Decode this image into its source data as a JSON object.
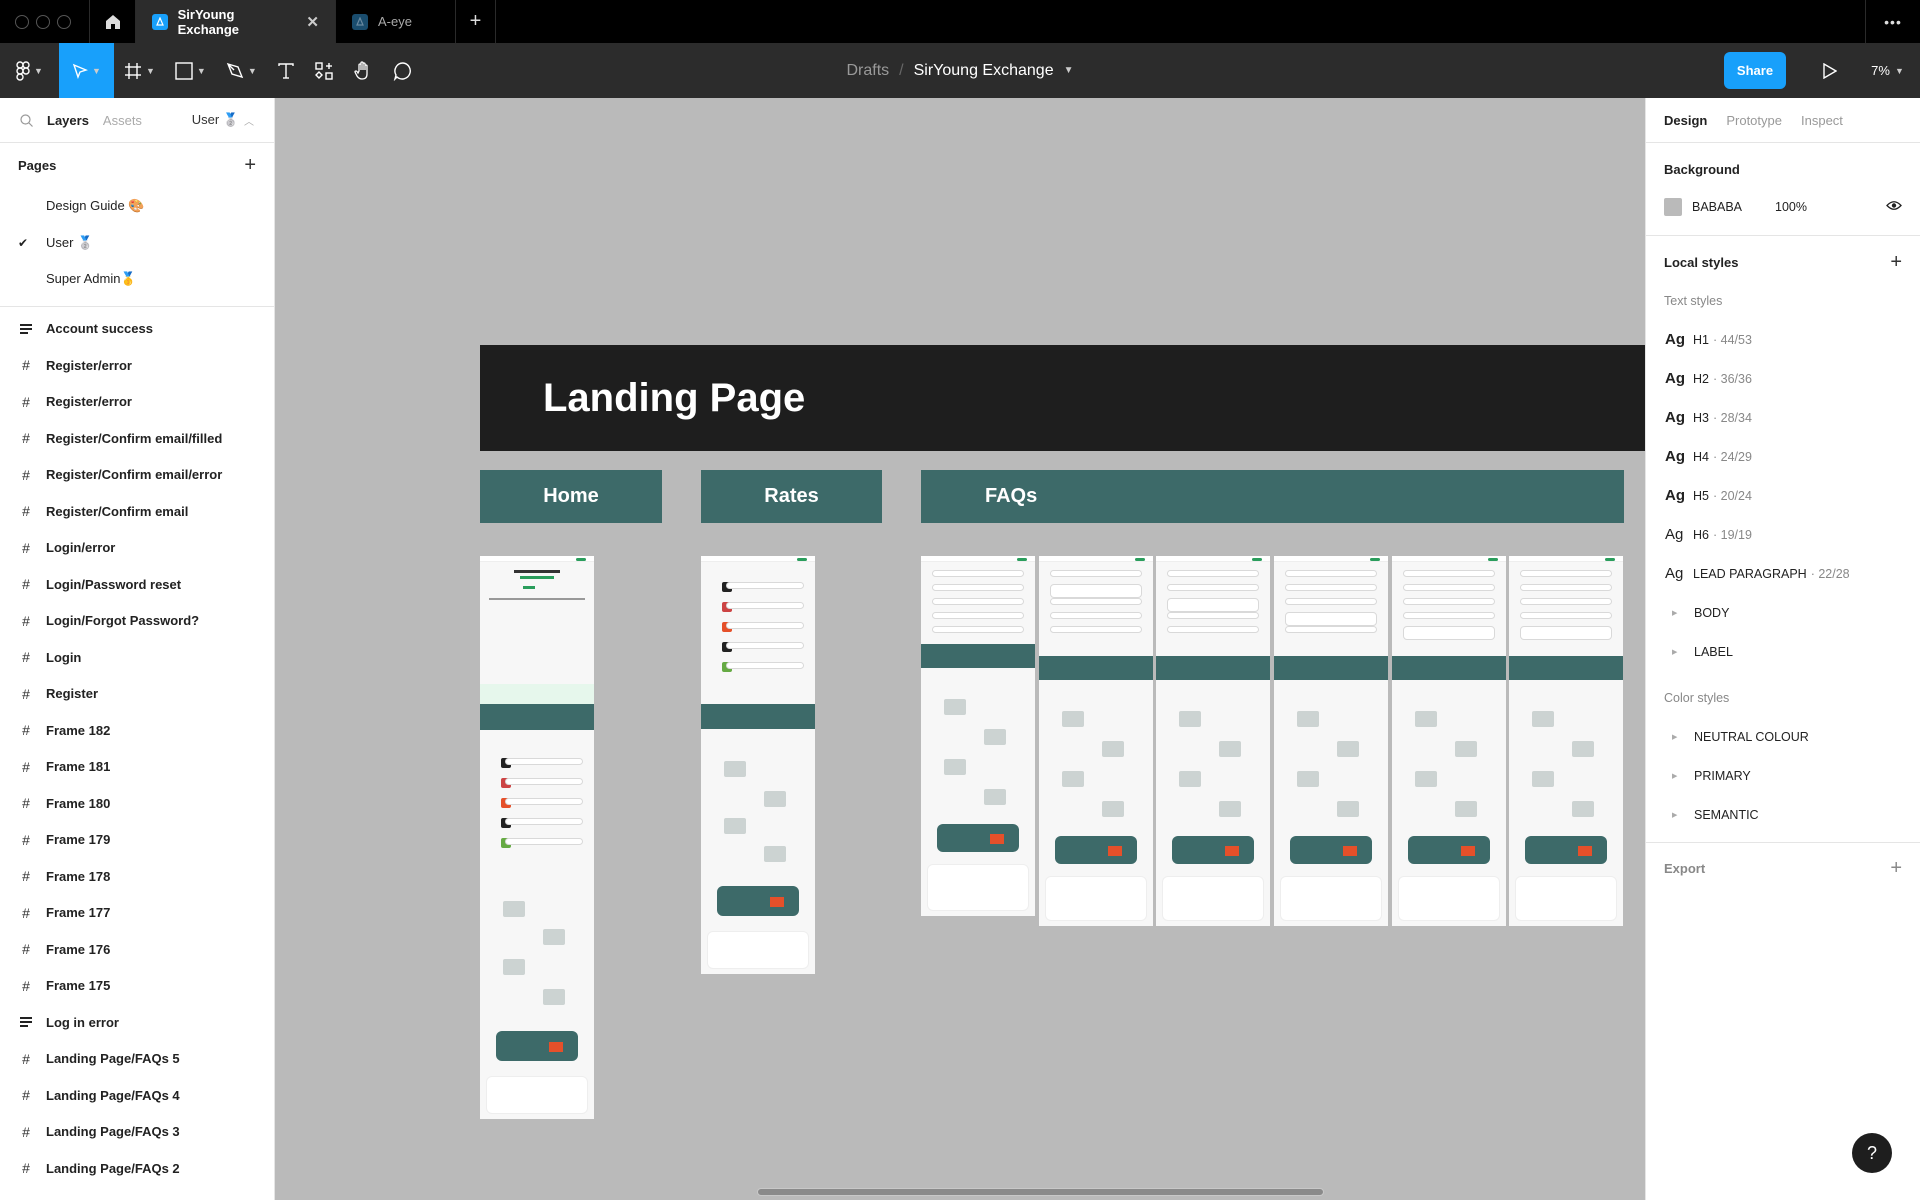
{
  "titlebar": {
    "tabs": [
      {
        "label": "SirYoung Exchange",
        "active": true,
        "close": "✕"
      },
      {
        "label": "A-eye",
        "active": false
      }
    ],
    "new_tab": "+",
    "more": "•••"
  },
  "toolbar": {
    "tools": [
      "main-menu",
      "move",
      "frame",
      "shape",
      "pen",
      "text",
      "resources",
      "hand",
      "comment"
    ],
    "breadcrumb": {
      "parent": "Drafts",
      "separator": "/",
      "file": "SirYoung Exchange"
    },
    "share_label": "Share",
    "zoom_level": "7%"
  },
  "left_panel": {
    "tabs": {
      "layers": "Layers",
      "assets": "Assets"
    },
    "current_page": "User 🥈",
    "pages_title": "Pages",
    "pages": [
      {
        "label": "Design Guide 🎨",
        "selected": false
      },
      {
        "label": "User 🥈",
        "selected": true
      },
      {
        "label": "Super Admin🥇",
        "selected": false
      }
    ],
    "layers": [
      {
        "label": "Account success",
        "type": "text"
      },
      {
        "label": "Register/error",
        "type": "frame"
      },
      {
        "label": "Register/error",
        "type": "frame"
      },
      {
        "label": "Register/Confirm email/filled",
        "type": "frame"
      },
      {
        "label": "Register/Confirm email/error",
        "type": "frame"
      },
      {
        "label": "Register/Confirm email",
        "type": "frame"
      },
      {
        "label": "Login/error",
        "type": "frame"
      },
      {
        "label": "Login/Password reset",
        "type": "frame"
      },
      {
        "label": "Login/Forgot Password?",
        "type": "frame"
      },
      {
        "label": "Login",
        "type": "frame"
      },
      {
        "label": "Register",
        "type": "frame"
      },
      {
        "label": "Frame 182",
        "type": "frame"
      },
      {
        "label": "Frame 181",
        "type": "frame"
      },
      {
        "label": "Frame 180",
        "type": "frame"
      },
      {
        "label": "Frame 179",
        "type": "frame"
      },
      {
        "label": "Frame 178",
        "type": "frame"
      },
      {
        "label": "Frame 177",
        "type": "frame"
      },
      {
        "label": "Frame 176",
        "type": "frame"
      },
      {
        "label": "Frame 175",
        "type": "frame"
      },
      {
        "label": "Log in error",
        "type": "text"
      },
      {
        "label": "Landing Page/FAQs 5",
        "type": "frame"
      },
      {
        "label": "Landing Page/FAQs 4",
        "type": "frame"
      },
      {
        "label": "Landing Page/FAQs 3",
        "type": "frame"
      },
      {
        "label": "Landing Page/FAQs 2",
        "type": "frame"
      }
    ]
  },
  "canvas": {
    "banner_title": "Landing Page",
    "sections": [
      {
        "label": "Home"
      },
      {
        "label": "Rates"
      },
      {
        "label": "FAQs"
      }
    ],
    "brand_color": "#3d6a69"
  },
  "right_panel": {
    "tabs": {
      "design": "Design",
      "prototype": "Prototype",
      "inspect": "Inspect"
    },
    "background": {
      "title": "Background",
      "hex": "BABABA",
      "opacity": "100%"
    },
    "local_styles": {
      "title": "Local styles",
      "text_styles_title": "Text styles",
      "text_styles": [
        {
          "ag": "Ag",
          "name": "H1",
          "meta": "· 44/53"
        },
        {
          "ag": "Ag",
          "name": "H2",
          "meta": "· 36/36"
        },
        {
          "ag": "Ag",
          "name": "H3",
          "meta": "· 28/34"
        },
        {
          "ag": "Ag",
          "name": "H4",
          "meta": "· 24/29"
        },
        {
          "ag": "Ag",
          "name": "H5",
          "meta": "· 20/24"
        },
        {
          "ag": "Ag",
          "name": "H6",
          "meta": "· 19/19"
        },
        {
          "ag": "Ag",
          "name": "LEAD PARAGRAPH",
          "meta": "· 22/28"
        }
      ],
      "text_groups": [
        "BODY",
        "LABEL"
      ],
      "color_styles_title": "Color styles",
      "color_groups": [
        "NEUTRAL COLOUR",
        "PRIMARY",
        "SEMANTIC"
      ]
    },
    "export_title": "Export"
  },
  "help_label": "?"
}
